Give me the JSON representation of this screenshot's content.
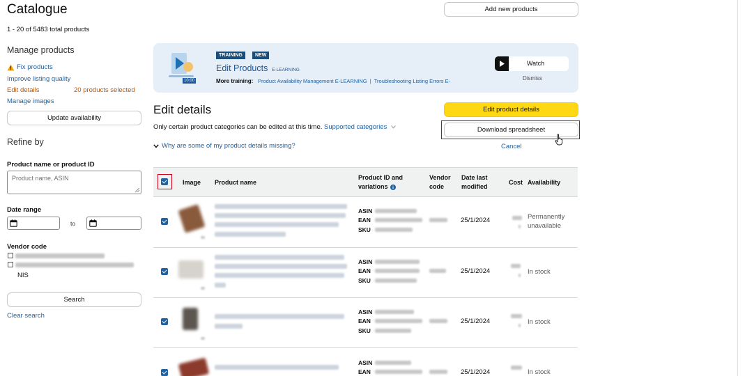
{
  "page": {
    "title": "Catalogue",
    "total_summary": "1 - 20 of 5483 total products"
  },
  "header": {
    "add_products_label": "Add new products"
  },
  "sidebar": {
    "manage_heading": "Manage products",
    "fix_products": "Fix products",
    "improve_quality": "Improve listing quality",
    "edit_details": "Edit details",
    "selected_count": "20 products selected",
    "manage_images": "Manage images",
    "update_availability": "Update availability",
    "refine_heading": "Refine by",
    "product_filter_label": "Product name or product ID",
    "product_filter_placeholder": "Product name, ASIN",
    "date_range_label": "Date range",
    "date_to": "to",
    "vendor_code_label": "Vendor code",
    "vendor_option_nis": "NIS",
    "search_label": "Search",
    "clear_search": "Clear search"
  },
  "banner": {
    "badge_training": "TRAINING",
    "badge_new": "NEW",
    "title": "Edit Products",
    "title_suffix": "E-LEARNING",
    "duration": "10:00",
    "more_training_label": "More training:",
    "more_training_links": "Product Availability Management E-LEARNING  |  Troubleshooting Listing Errors E-",
    "watch_label": "Watch",
    "dismiss_label": "Dismiss"
  },
  "edit": {
    "heading": "Edit details",
    "note": "Only certain product categories can be edited at this time.",
    "supported_link": "Supported categories",
    "missing_link": "Why are some of my product details missing?",
    "edit_button": "Edit product details",
    "download_button": "Download spreadsheet",
    "cancel": "Cancel"
  },
  "table": {
    "headers": {
      "image": "Image",
      "product_name": "Product name",
      "product_id_line1": "Product ID and",
      "product_id_line2": "variations",
      "vendor_line1": "Vendor",
      "vendor_line2": "code",
      "date_line1": "Date last",
      "date_line2": "modified",
      "cost": "Cost",
      "availability": "Availability"
    },
    "id_labels": {
      "asin": "ASIN",
      "ean": "EAN",
      "sku": "SKU"
    },
    "rows": [
      {
        "date": "25/1/2024",
        "availability_line1": "Permanently",
        "availability_line2": "unavailable",
        "thumb_color": "#8a5a3c"
      },
      {
        "date": "25/1/2024",
        "availability_line1": "In stock",
        "availability_line2": "",
        "thumb_color": "#d6d2cc"
      },
      {
        "date": "25/1/2024",
        "availability_line1": "In stock",
        "availability_line2": "",
        "thumb_color": "#5d5650"
      },
      {
        "date": "25/1/2024",
        "availability_line1": "In stock",
        "availability_line2": "",
        "thumb_color": "#8c3a2c"
      }
    ]
  },
  "colors": {
    "link": "#2162a1",
    "primary_button": "#ffd814",
    "edit_details": "#c45500",
    "highlight_box": "#d0021b",
    "banner_bg": "#e6eef8"
  }
}
